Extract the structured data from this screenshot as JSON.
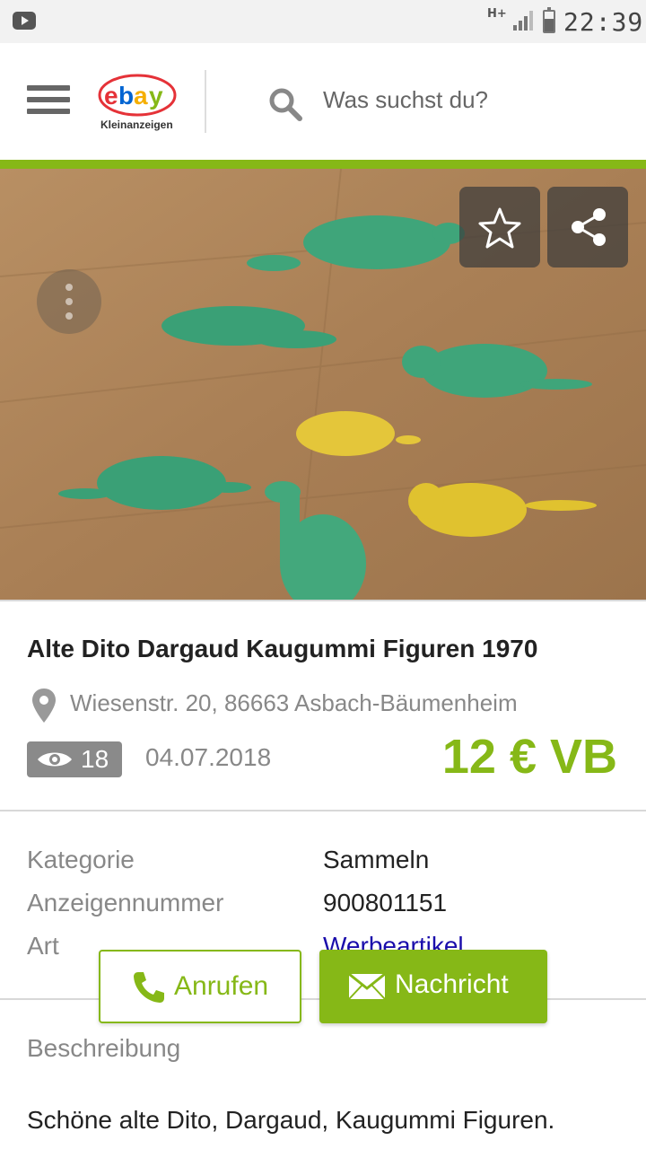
{
  "status_bar": {
    "network_type": "H+",
    "time": "22:39",
    "icons": [
      "youtube-icon",
      "signal-icon",
      "battery-icon"
    ]
  },
  "header": {
    "logo_text": "ebay",
    "logo_subtext": "Kleinanzeigen",
    "search_placeholder": "Was suchst du?",
    "icons": [
      "menu-icon",
      "search-icon"
    ]
  },
  "colors": {
    "brand_green": "#86b817",
    "header_bg": "#ffffff",
    "link_blue": "#1a0dab"
  },
  "photo": {
    "actions": [
      "star-icon",
      "share-icon",
      "more-vertical-icon"
    ]
  },
  "ad": {
    "title": "Alte Dito Dargaud Kaugummi Figuren 1970",
    "location": "Wiesenstr. 20, 86663 Asbach-Bäumenheim",
    "views": "18",
    "date": "04.07.2018",
    "price": "12 € VB"
  },
  "details": [
    {
      "label": "Kategorie",
      "value": "Sammeln"
    },
    {
      "label": "Anzeigennummer",
      "value": "900801151"
    },
    {
      "label": "Art",
      "value": "Werbeartikel"
    }
  ],
  "description": {
    "title": "Beschreibung",
    "text": "Schöne alte Dito, Dargaud, Kaugummi Figuren."
  },
  "actions": {
    "call_label": "Anrufen",
    "message_label": "Nachricht"
  }
}
